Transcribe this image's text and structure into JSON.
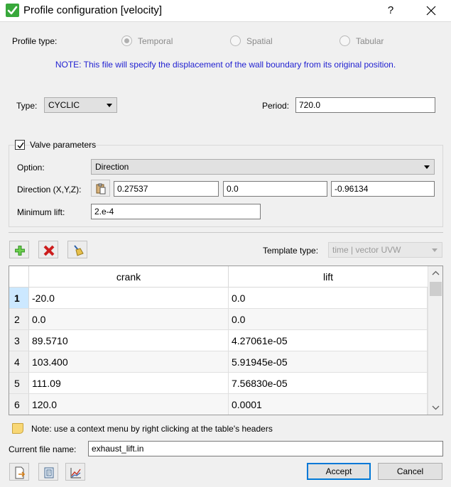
{
  "window": {
    "title": "Profile configuration [velocity]",
    "help_label": "?"
  },
  "profile_type": {
    "label": "Profile type:",
    "options": [
      {
        "label": "Temporal",
        "checked": true
      },
      {
        "label": "Spatial",
        "checked": false
      },
      {
        "label": "Tabular",
        "checked": false
      }
    ]
  },
  "note_text": "NOTE: This file will specify the displacement of the wall boundary from its original position.",
  "type": {
    "label": "Type:",
    "value": "CYCLIC"
  },
  "period": {
    "label": "Period:",
    "value": "720.0"
  },
  "valve": {
    "checkbox_label": "Valve parameters",
    "checked": true,
    "option_label": "Option:",
    "option_value": "Direction",
    "direction_label": "Direction (X,Y,Z):",
    "direction_x": "0.27537",
    "direction_y": "0.0",
    "direction_z": "-0.96134",
    "min_lift_label": "Minimum lift:",
    "min_lift_value": "2.e-4"
  },
  "toolbar": {
    "template_type_label": "Template type:",
    "template_type_value": "time | vector UVW"
  },
  "table": {
    "columns": [
      "crank",
      "lift"
    ],
    "rows": [
      {
        "index": "1",
        "crank": "-20.0",
        "lift": "0.0"
      },
      {
        "index": "2",
        "crank": "0.0",
        "lift": "0.0"
      },
      {
        "index": "3",
        "crank": "89.5710",
        "lift": "4.27061e-05"
      },
      {
        "index": "4",
        "crank": "103.400",
        "lift": "5.91945e-05"
      },
      {
        "index": "5",
        "crank": "111.09",
        "lift": "7.56830e-05"
      },
      {
        "index": "6",
        "crank": "120.0",
        "lift": "0.0001"
      }
    ]
  },
  "context_note": "Note: use a context menu by right clicking at the table's headers",
  "file": {
    "label": "Current file name:",
    "value": "exhaust_lift.in"
  },
  "buttons": {
    "accept": "Accept",
    "cancel": "Cancel"
  },
  "colors": {
    "accent": "#0078d7",
    "note_blue": "#1f1fd1",
    "check_green": "#38a83b"
  }
}
